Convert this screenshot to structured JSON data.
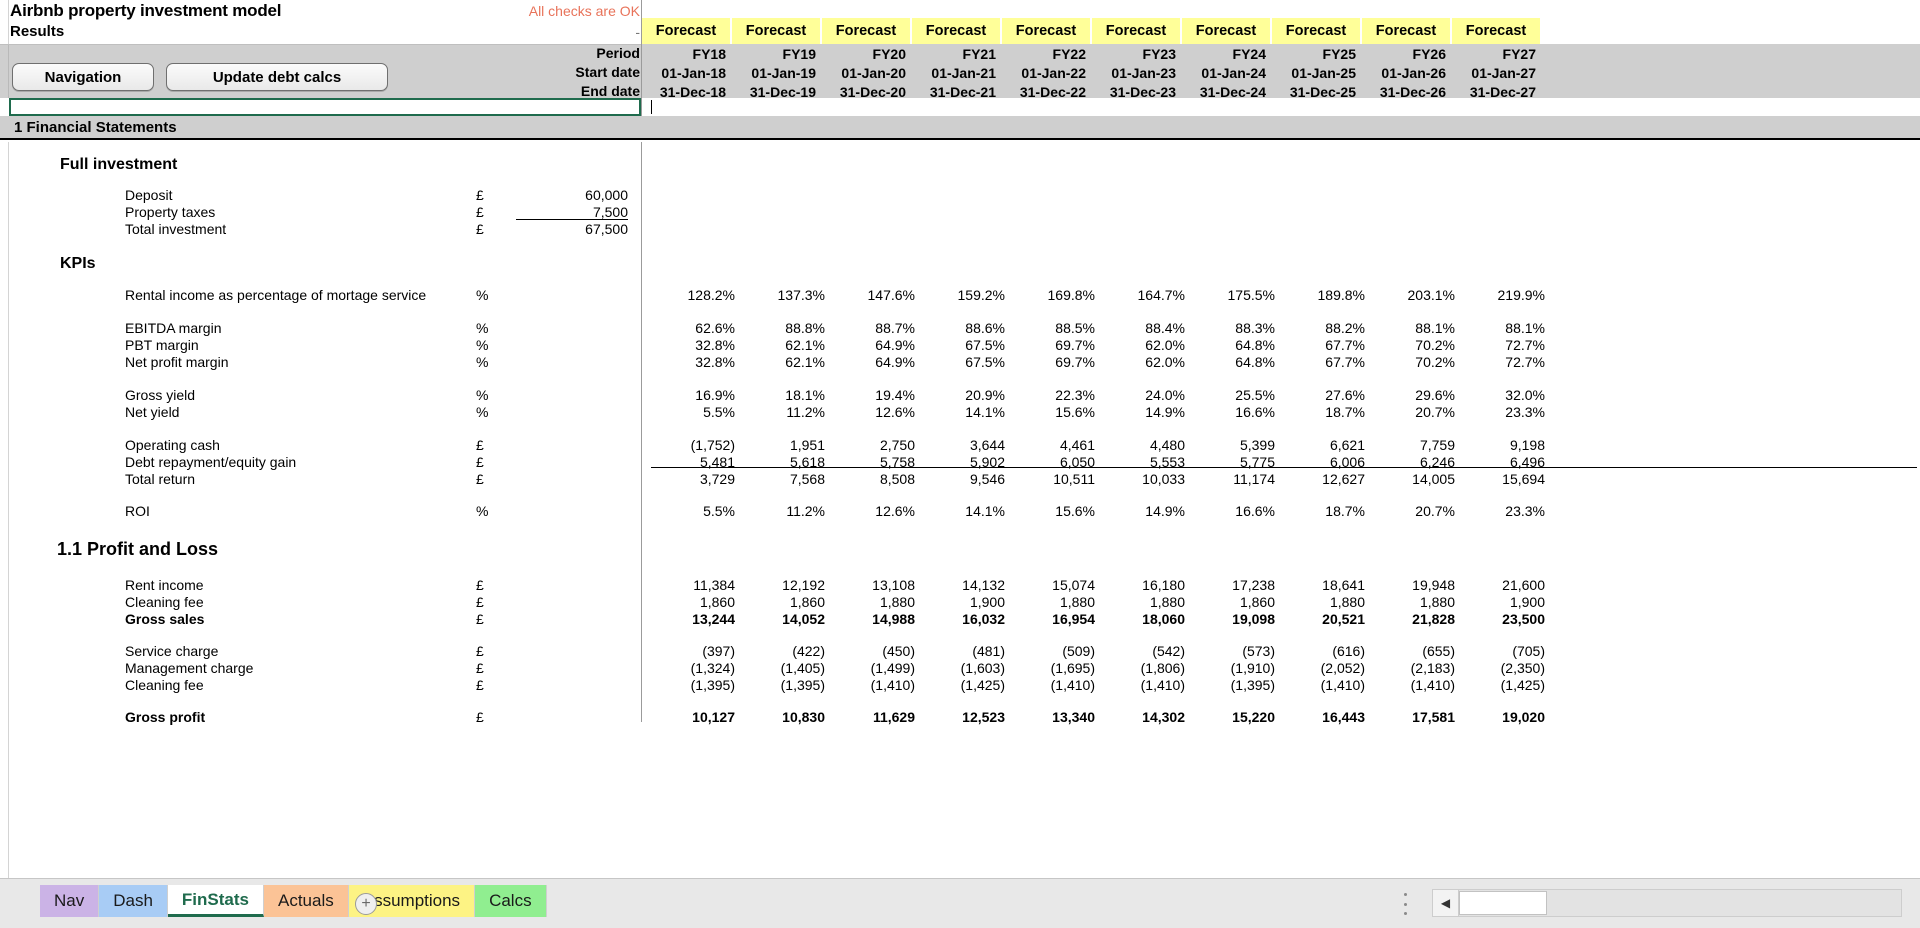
{
  "header": {
    "model_title": "Airbnb property investment model",
    "results_label": "Results",
    "checks_status": "All checks are OK",
    "checks_value": "-",
    "nav_button": "Navigation",
    "update_button": "Update debt calcs",
    "period_row_label": "Period",
    "start_date_row_label": "Start date",
    "end_date_row_label": "End date",
    "forecast_label": "Forecast"
  },
  "columns": [
    {
      "scenario": "Forecast",
      "period": "FY18",
      "start": "01-Jan-18",
      "end": "31-Dec-18"
    },
    {
      "scenario": "Forecast",
      "period": "FY19",
      "start": "01-Jan-19",
      "end": "31-Dec-19"
    },
    {
      "scenario": "Forecast",
      "period": "FY20",
      "start": "01-Jan-20",
      "end": "31-Dec-20"
    },
    {
      "scenario": "Forecast",
      "period": "FY21",
      "start": "01-Jan-21",
      "end": "31-Dec-21"
    },
    {
      "scenario": "Forecast",
      "period": "FY22",
      "start": "01-Jan-22",
      "end": "31-Dec-22"
    },
    {
      "scenario": "Forecast",
      "period": "FY23",
      "start": "01-Jan-23",
      "end": "31-Dec-23"
    },
    {
      "scenario": "Forecast",
      "period": "FY24",
      "start": "01-Jan-24",
      "end": "31-Dec-24"
    },
    {
      "scenario": "Forecast",
      "period": "FY25",
      "start": "01-Jan-25",
      "end": "31-Dec-25"
    },
    {
      "scenario": "Forecast",
      "period": "FY26",
      "start": "01-Jan-26",
      "end": "31-Dec-26"
    },
    {
      "scenario": "Forecast",
      "period": "FY27",
      "start": "01-Jan-27",
      "end": "31-Dec-27"
    }
  ],
  "section": {
    "number_title": "1 Financial Statements"
  },
  "full_investment": {
    "heading": "Full investment",
    "rows": [
      {
        "label": "Deposit",
        "unit": "£",
        "value": "60,000"
      },
      {
        "label": "Property taxes",
        "unit": "£",
        "value": "7,500"
      },
      {
        "label": "Total investment",
        "unit": "£",
        "value": "67,500"
      }
    ]
  },
  "kpis": {
    "heading": "KPIs",
    "rows": [
      {
        "label": "Rental income as percentage of mortage service",
        "unit": "%",
        "values": [
          "128.2%",
          "137.3%",
          "147.6%",
          "159.2%",
          "169.8%",
          "164.7%",
          "175.5%",
          "189.8%",
          "203.1%",
          "219.9%"
        ]
      },
      {
        "label": "EBITDA margin",
        "unit": "%",
        "values": [
          "62.6%",
          "88.8%",
          "88.7%",
          "88.6%",
          "88.5%",
          "88.4%",
          "88.3%",
          "88.2%",
          "88.1%",
          "88.1%"
        ]
      },
      {
        "label": "PBT margin",
        "unit": "%",
        "values": [
          "32.8%",
          "62.1%",
          "64.9%",
          "67.5%",
          "69.7%",
          "62.0%",
          "64.8%",
          "67.7%",
          "70.2%",
          "72.7%"
        ]
      },
      {
        "label": "Net profit margin",
        "unit": "%",
        "values": [
          "32.8%",
          "62.1%",
          "64.9%",
          "67.5%",
          "69.7%",
          "62.0%",
          "64.8%",
          "67.7%",
          "70.2%",
          "72.7%"
        ]
      },
      {
        "label": "Gross yield",
        "unit": "%",
        "values": [
          "16.9%",
          "18.1%",
          "19.4%",
          "20.9%",
          "22.3%",
          "24.0%",
          "25.5%",
          "27.6%",
          "29.6%",
          "32.0%"
        ]
      },
      {
        "label": "Net yield",
        "unit": "%",
        "values": [
          "5.5%",
          "11.2%",
          "12.6%",
          "14.1%",
          "15.6%",
          "14.9%",
          "16.6%",
          "18.7%",
          "20.7%",
          "23.3%"
        ]
      },
      {
        "label": "Operating cash",
        "unit": "£",
        "values": [
          "(1,752)",
          "1,951",
          "2,750",
          "3,644",
          "4,461",
          "4,480",
          "5,399",
          "6,621",
          "7,759",
          "9,198"
        ]
      },
      {
        "label": "Debt repayment/equity gain",
        "unit": "£",
        "values": [
          "5,481",
          "5,618",
          "5,758",
          "5,902",
          "6,050",
          "5,553",
          "5,775",
          "6,006",
          "6,246",
          "6,496"
        ]
      },
      {
        "label": "Total return",
        "unit": "£",
        "values": [
          "3,729",
          "7,568",
          "8,508",
          "9,546",
          "10,511",
          "10,033",
          "11,174",
          "12,627",
          "14,005",
          "15,694"
        ]
      },
      {
        "label": "ROI",
        "unit": "%",
        "values": [
          "5.5%",
          "11.2%",
          "12.6%",
          "14.1%",
          "15.6%",
          "14.9%",
          "16.6%",
          "18.7%",
          "20.7%",
          "23.3%"
        ]
      }
    ]
  },
  "profit_and_loss": {
    "heading": "1.1 Profit and Loss",
    "rows": [
      {
        "label": "Rent income",
        "unit": "£",
        "bold": false,
        "values": [
          "11,384",
          "12,192",
          "13,108",
          "14,132",
          "15,074",
          "16,180",
          "17,238",
          "18,641",
          "19,948",
          "21,600"
        ]
      },
      {
        "label": "Cleaning fee",
        "unit": "£",
        "bold": false,
        "values": [
          "1,860",
          "1,860",
          "1,880",
          "1,900",
          "1,880",
          "1,880",
          "1,860",
          "1,880",
          "1,880",
          "1,900"
        ]
      },
      {
        "label": "Gross sales",
        "unit": "£",
        "bold": true,
        "values": [
          "13,244",
          "14,052",
          "14,988",
          "16,032",
          "16,954",
          "18,060",
          "19,098",
          "20,521",
          "21,828",
          "23,500"
        ]
      },
      {
        "label": "Service charge",
        "unit": "£",
        "bold": false,
        "values": [
          "(397)",
          "(422)",
          "(450)",
          "(481)",
          "(509)",
          "(542)",
          "(573)",
          "(616)",
          "(655)",
          "(705)"
        ]
      },
      {
        "label": "Management charge",
        "unit": "£",
        "bold": false,
        "values": [
          "(1,324)",
          "(1,405)",
          "(1,499)",
          "(1,603)",
          "(1,695)",
          "(1,806)",
          "(1,910)",
          "(2,052)",
          "(2,183)",
          "(2,350)"
        ]
      },
      {
        "label": "Cleaning fee",
        "unit": "£",
        "bold": false,
        "values": [
          "(1,395)",
          "(1,395)",
          "(1,410)",
          "(1,425)",
          "(1,410)",
          "(1,410)",
          "(1,395)",
          "(1,410)",
          "(1,410)",
          "(1,425)"
        ]
      },
      {
        "label": "Gross profit",
        "unit": "£",
        "bold": true,
        "values": [
          "10,127",
          "10,830",
          "11,629",
          "12,523",
          "13,340",
          "14,302",
          "15,220",
          "16,443",
          "17,581",
          "19,020"
        ]
      }
    ]
  },
  "sheet_tabs": [
    {
      "name": "Nav",
      "color": "#cbb3e6",
      "active": false
    },
    {
      "name": "Dash",
      "color": "#a8ccf5",
      "active": false
    },
    {
      "name": "FinStats",
      "color": "#ffffff",
      "active": true
    },
    {
      "name": "Actuals",
      "color": "#fbc396",
      "active": false
    },
    {
      "name": "Assumptions",
      "color": "#fdf384",
      "active": false
    },
    {
      "name": "Calcs",
      "color": "#90ee90",
      "active": false
    }
  ],
  "statusbar": {
    "add_sheet_label": "+",
    "scroll_left_label": "◀"
  }
}
